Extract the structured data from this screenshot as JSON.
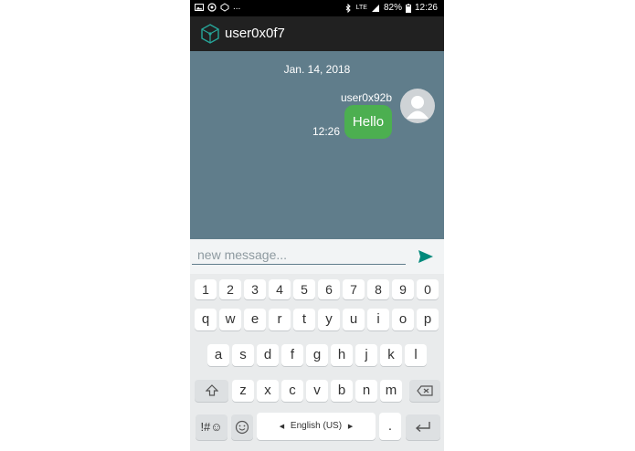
{
  "status_bar": {
    "battery": "82%",
    "time": "12:26",
    "ellipsis": "...",
    "network": "LTE"
  },
  "app_bar": {
    "title": "user0x0f7",
    "logo_icon": "cube-network-icon"
  },
  "chat": {
    "date": "Jan. 14, 2018",
    "messages": [
      {
        "sender": "user0x92b",
        "text": "Hello",
        "time": "12:26"
      }
    ]
  },
  "composer": {
    "placeholder": "new message...",
    "value": "",
    "send_icon": "send-icon"
  },
  "keyboard": {
    "row_numbers": [
      "1",
      "2",
      "3",
      "4",
      "5",
      "6",
      "7",
      "8",
      "9",
      "0"
    ],
    "row1": [
      "q",
      "w",
      "e",
      "r",
      "t",
      "y",
      "u",
      "i",
      "o",
      "p"
    ],
    "row2": [
      "a",
      "s",
      "d",
      "f",
      "g",
      "h",
      "j",
      "k",
      "l"
    ],
    "row3": [
      "z",
      "x",
      "c",
      "v",
      "b",
      "n",
      "m"
    ],
    "symbols_label": "!#☺",
    "language_label": "English (US)",
    "period_label": "."
  },
  "colors": {
    "chat_bg": "#607D8B",
    "bubble": "#4CAF50",
    "app_bar": "#212121",
    "accent": "#00897B"
  }
}
